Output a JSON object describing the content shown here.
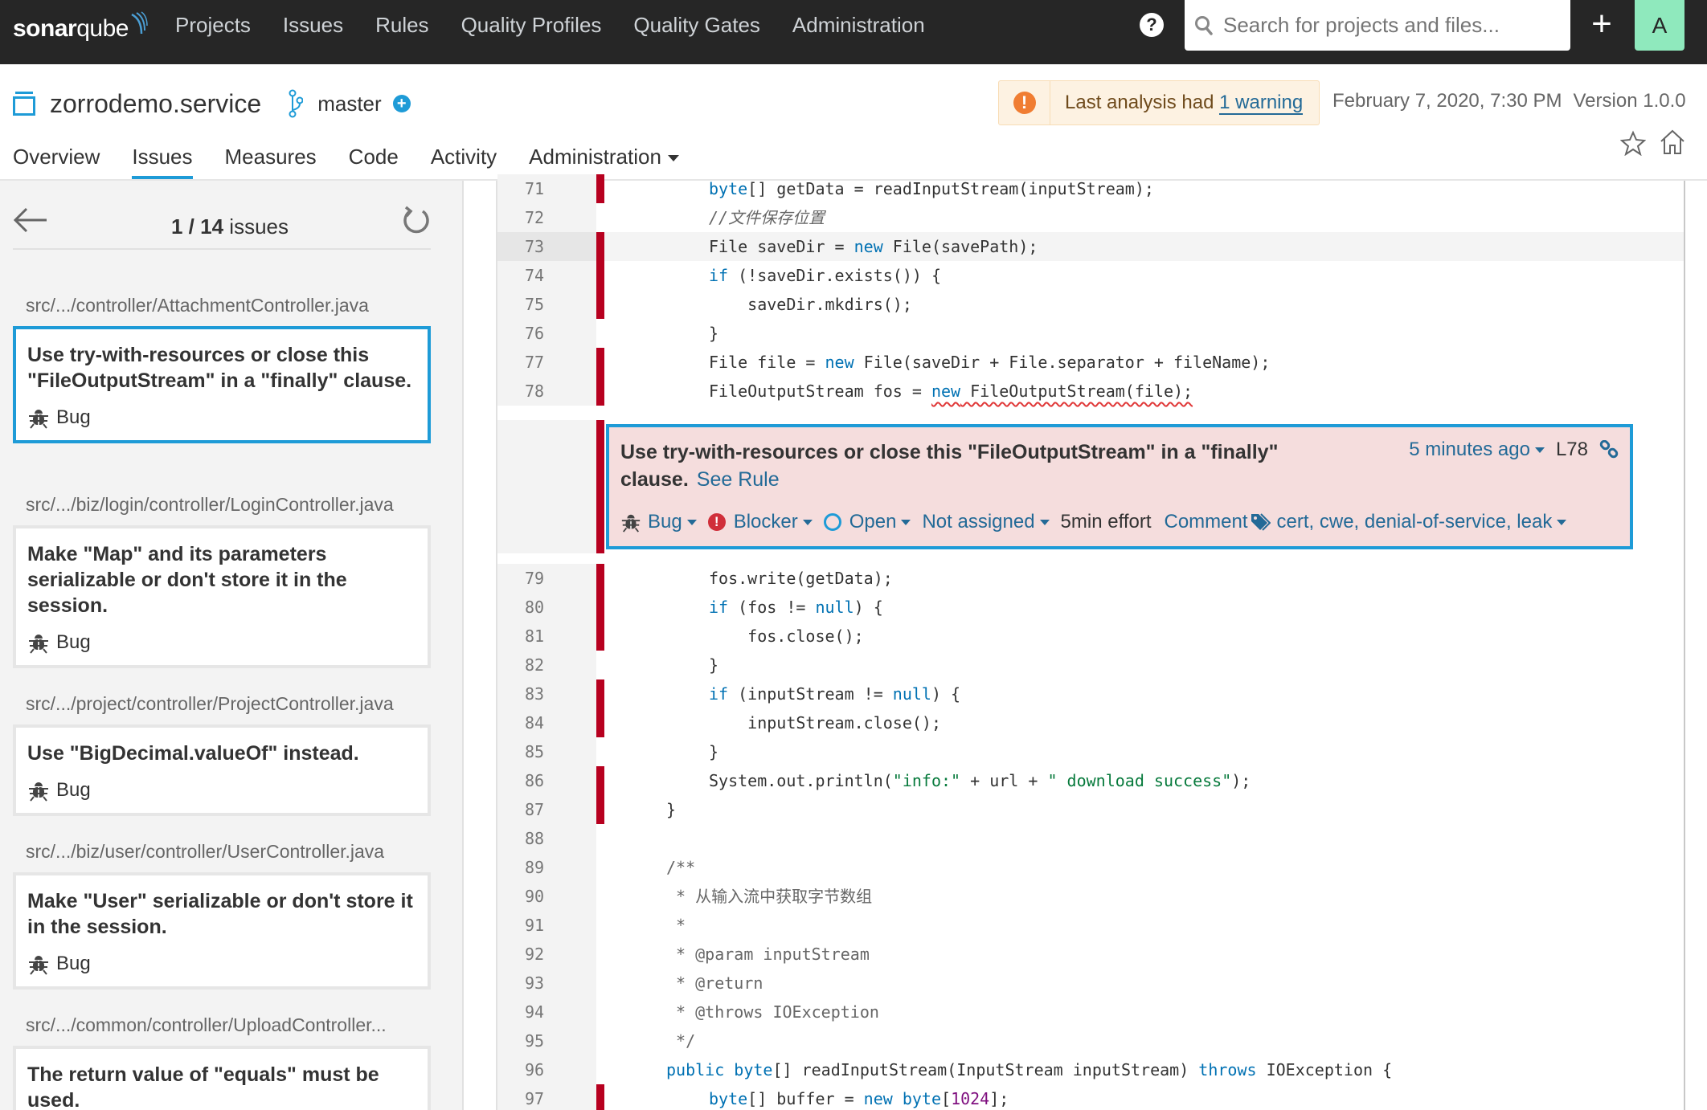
{
  "nav": {
    "logo_bold": "sonar",
    "logo_light": "qube",
    "links": [
      "Projects",
      "Issues",
      "Rules",
      "Quality Profiles",
      "Quality Gates",
      "Administration"
    ],
    "help_icon": "?",
    "search_placeholder": "Search for projects and files...",
    "plus_icon": "+",
    "avatar_letter": "A"
  },
  "project": {
    "name": "zorrodemo.service",
    "branch": "master",
    "branch_add_icon": "+",
    "warning_prefix": "Last analysis had ",
    "warning_link": "1 warning",
    "date": "February 7, 2020, 7:30 PM",
    "version": "Version 1.0.0"
  },
  "tabs": [
    {
      "label": "Overview",
      "active": false
    },
    {
      "label": "Issues",
      "active": true
    },
    {
      "label": "Measures",
      "active": false
    },
    {
      "label": "Code",
      "active": false
    },
    {
      "label": "Activity",
      "active": false
    },
    {
      "label": "Administration",
      "active": false,
      "dropdown": true
    }
  ],
  "sidebar": {
    "count_current": "1 / 14",
    "count_suffix": " issues",
    "groups": [
      {
        "file": "src/.../controller/AttachmentController.java",
        "message": "Use try-with-resources or close this \"FileOutputStream\" in a \"finally\" clause.",
        "type": "Bug",
        "selected": true
      },
      {
        "file": "src/.../biz/login/controller/LoginController.java",
        "message": "Make \"Map\" and its parameters serializable or don't store it in the session.",
        "type": "Bug",
        "selected": false
      },
      {
        "file": "src/.../project/controller/ProjectController.java",
        "message": "Use \"BigDecimal.valueOf\" instead.",
        "type": "Bug",
        "selected": false
      },
      {
        "file": "src/.../biz/user/controller/UserController.java",
        "message": "Make \"User\" serializable or don't store it in the session.",
        "type": "Bug",
        "selected": false
      },
      {
        "file": "src/.../common/controller/UploadController...",
        "message": "The return value of \"equals\" must be used.",
        "type": "",
        "selected": false
      }
    ]
  },
  "code": {
    "lines": [
      {
        "n": "71",
        "covered": true
      },
      {
        "n": "72",
        "covered": false
      },
      {
        "n": "73",
        "covered": true,
        "highlight": true
      },
      {
        "n": "74",
        "covered": true
      },
      {
        "n": "75",
        "covered": true
      },
      {
        "n": "76",
        "covered": false
      },
      {
        "n": "77",
        "covered": true
      },
      {
        "n": "78",
        "covered": true
      },
      {
        "n": "79",
        "covered": true
      },
      {
        "n": "80",
        "covered": true
      },
      {
        "n": "81",
        "covered": true
      },
      {
        "n": "82",
        "covered": false
      },
      {
        "n": "83",
        "covered": true
      },
      {
        "n": "84",
        "covered": true
      },
      {
        "n": "85",
        "covered": false
      },
      {
        "n": "86",
        "covered": true
      },
      {
        "n": "87",
        "covered": true
      },
      {
        "n": "88",
        "covered": false
      },
      {
        "n": "89",
        "covered": false
      },
      {
        "n": "90",
        "covered": false
      },
      {
        "n": "91",
        "covered": false
      },
      {
        "n": "92",
        "covered": false
      },
      {
        "n": "93",
        "covered": false
      },
      {
        "n": "94",
        "covered": false
      },
      {
        "n": "95",
        "covered": false
      },
      {
        "n": "96",
        "covered": false
      },
      {
        "n": "97",
        "covered": true
      }
    ],
    "text": {
      "l71": [
        "byte",
        "[] getData = readInputStream(inputStream);"
      ],
      "l72": "//文件保存位置",
      "l73": [
        "File saveDir = ",
        "new",
        " File(savePath);"
      ],
      "l74": [
        "if",
        " (!saveDir.exists()) {"
      ],
      "l75": "    saveDir.mkdirs();",
      "l76": "}",
      "l77": [
        "File file = ",
        "new",
        " File(saveDir + File.separator + fileName);"
      ],
      "l78": [
        "FileOutputStream fos = ",
        "new",
        " FileOutputStream(file);"
      ],
      "l79": "fos.write(getData);",
      "l80": [
        "if",
        " (fos != ",
        "null",
        ") {"
      ],
      "l81": "    fos.close();",
      "l82": "}",
      "l83": [
        "if",
        " (inputStream != ",
        "null",
        ") {"
      ],
      "l84": "    inputStream.close();",
      "l85": "}",
      "l86": [
        "System.out.println(",
        "\"info:\"",
        " + url + ",
        "\" download success\"",
        ");"
      ],
      "l87": "}",
      "l89": "/**",
      "l90": " * 从输入流中获取字节数组",
      "l91": " *",
      "l92": " * @param inputStream",
      "l93": " * @return",
      "l94": " * @throws IOException",
      "l95": " */",
      "l96": [
        "public",
        " ",
        "byte",
        "[] readInputStream(InputStream inputStream) ",
        "throws",
        " IOException {"
      ],
      "l97": [
        "byte",
        "[] buffer = ",
        "new",
        " ",
        "byte",
        "[",
        "1024",
        "];"
      ]
    }
  },
  "issue_box": {
    "message": "Use try-with-resources or close this \"FileOutputStream\" in a \"finally\" clause.",
    "see_rule": "See Rule",
    "time": "5 minutes ago",
    "line": "L78",
    "type": "Bug",
    "severity": "Blocker",
    "status": "Open",
    "assignee": "Not assigned",
    "effort": "5min effort",
    "comment": "Comment",
    "tags": "cert, cwe, denial-of-service, leak"
  },
  "colors": {
    "nav_bg": "#262626",
    "accent": "#1e9bd7",
    "link": "#236a97",
    "uncovered": "#b7001f",
    "issue_bg": "#f5dddd",
    "blocker": "#d02f3a",
    "avatar_bg": "#8fe9bd"
  }
}
